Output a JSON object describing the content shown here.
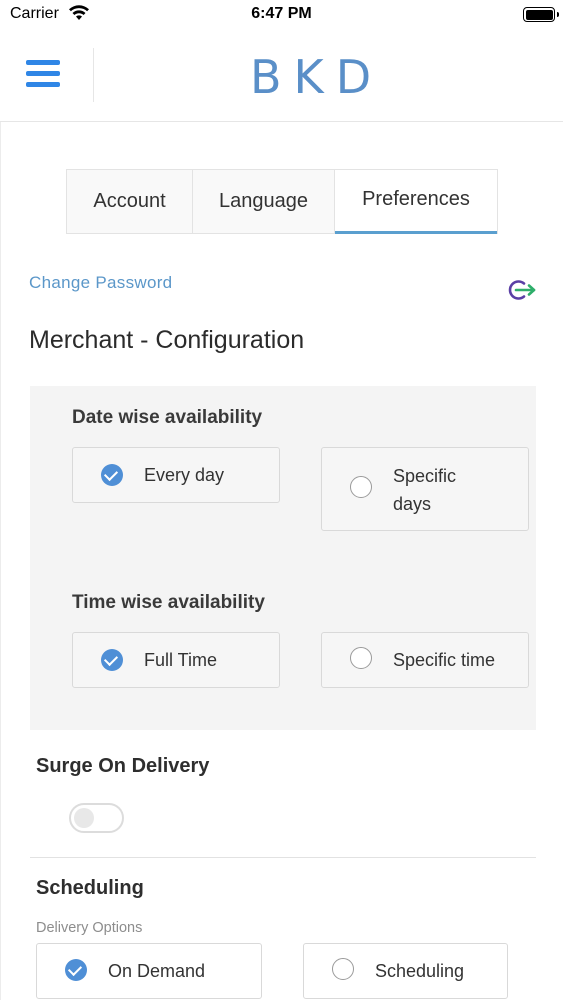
{
  "status_bar": {
    "carrier": "Carrier",
    "time": "6:47 PM"
  },
  "header": {
    "logo": "BKD"
  },
  "tabs": [
    {
      "label": "Account"
    },
    {
      "label": "Language"
    },
    {
      "label": "Preferences",
      "active": true
    }
  ],
  "change_password": "Change Password",
  "page_title": "Merchant - Configuration",
  "date_availability": {
    "heading": "Date wise availability",
    "options": [
      {
        "label": "Every day",
        "selected": true
      },
      {
        "label_line1": "Specific",
        "label_line2": "days",
        "selected": false
      }
    ]
  },
  "time_availability": {
    "heading": "Time wise availability",
    "options": [
      {
        "label": "Full Time",
        "selected": true
      },
      {
        "label": "Specific time",
        "selected": false
      }
    ]
  },
  "surge": {
    "title": "Surge On Delivery",
    "enabled": false
  },
  "scheduling": {
    "title": "Scheduling",
    "delivery_label": "Delivery Options",
    "options": [
      {
        "label": "On Demand",
        "selected": true
      },
      {
        "label": "Scheduling",
        "selected": false
      }
    ]
  },
  "colors": {
    "accent": "#2f86e6",
    "logo": "#5a8fc8",
    "link": "#5b97c9",
    "check": "#4f8fd6"
  },
  "icons": {
    "menu": "hamburger-menu-icon",
    "logout": "logout-icon",
    "wifi": "wifi-icon",
    "battery": "battery-icon"
  }
}
